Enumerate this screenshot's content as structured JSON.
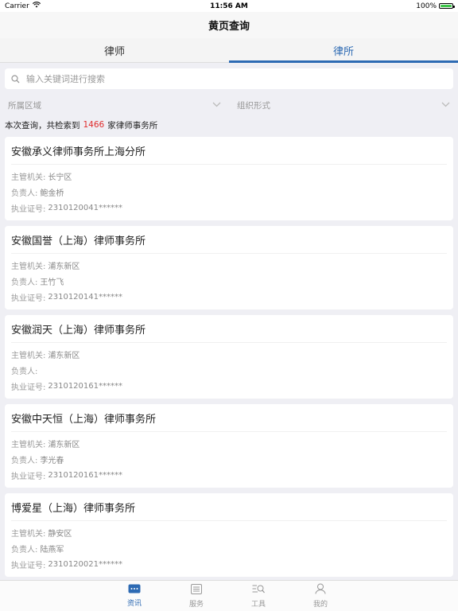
{
  "status_bar": {
    "carrier": "Carrier",
    "time": "11:56 AM",
    "battery": "100%"
  },
  "nav": {
    "title": "黄页查询"
  },
  "tabs": [
    {
      "label": "律师",
      "active": false
    },
    {
      "label": "律所",
      "active": true
    }
  ],
  "search": {
    "placeholder": "输入关键词进行搜索",
    "value": ""
  },
  "filters": {
    "region": "所属区域",
    "org_form": "组织形式"
  },
  "result": {
    "prefix": "本次查询，共检索到",
    "count": "1466",
    "suffix": "家律师事务所"
  },
  "labels": {
    "authority": "主管机关:",
    "head": "负责人:",
    "license": "执业证号:"
  },
  "firms": [
    {
      "name": "安徽承义律师事务所上海分所",
      "authority": "长宁区",
      "head": "鲍金桥",
      "license": "2310120041******"
    },
    {
      "name": "安徽国誉（上海）律师事务所",
      "authority": "浦东新区",
      "head": "王竹飞",
      "license": "2310120141******"
    },
    {
      "name": "安徽润天（上海）律师事务所",
      "authority": "浦东新区",
      "head": "",
      "license": "2310120161******"
    },
    {
      "name": "安徽中天恒（上海）律师事务所",
      "authority": "浦东新区",
      "head": "李光春",
      "license": "2310120161******"
    },
    {
      "name": "博爱星（上海）律师事务所",
      "authority": "静安区",
      "head": "陆燕军",
      "license": "2310120021******"
    }
  ],
  "tabbar": [
    {
      "label": "资讯",
      "icon": "news-icon",
      "active": true
    },
    {
      "label": "服务",
      "icon": "service-icon",
      "active": false
    },
    {
      "label": "工具",
      "icon": "tools-icon",
      "active": false
    },
    {
      "label": "我的",
      "icon": "profile-icon",
      "active": false
    }
  ],
  "colors": {
    "accent": "#2d6ab3",
    "count": "#e02c2c"
  }
}
